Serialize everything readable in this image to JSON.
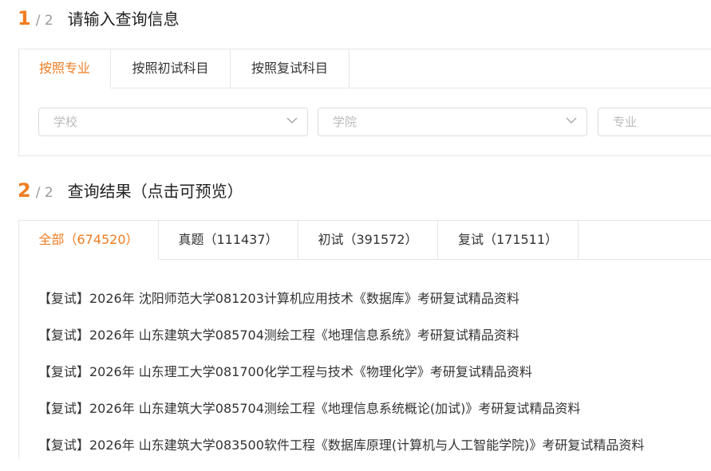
{
  "step1": {
    "num": "1",
    "slash": "/ 2",
    "title": "请输入查询信息"
  },
  "search_tabs": [
    "按照专业",
    "按照初试科目",
    "按照复试科目"
  ],
  "selects": {
    "school": {
      "placeholder": "学校"
    },
    "college": {
      "placeholder": "学院"
    },
    "major": {
      "placeholder": "专业"
    }
  },
  "step2": {
    "num": "2",
    "slash": "/ 2",
    "title": "查询结果（点击可预览）"
  },
  "result_tabs": [
    "全部（674520）",
    "真题（111437）",
    "初试（391572）",
    "复试（171511）"
  ],
  "results": [
    "【复试】2026年 沈阳师范大学081203计算机应用技术《数据库》考研复试精品资料",
    "【复试】2026年 山东建筑大学085704测绘工程《地理信息系统》考研复试精品资料",
    "【复试】2026年 山东理工大学081700化学工程与技术《物理化学》考研复试精品资料",
    "【复试】2026年 山东建筑大学085704测绘工程《地理信息系统概论(加试)》考研复试精品资料",
    "【复试】2026年 山东建筑大学083500软件工程《数据库原理(计算机与人工智能学院)》考研复试精品资料"
  ],
  "colors": {
    "accent": "#ef7d22",
    "border": "#e6e6e6",
    "placeholder": "#bbbbbb"
  }
}
